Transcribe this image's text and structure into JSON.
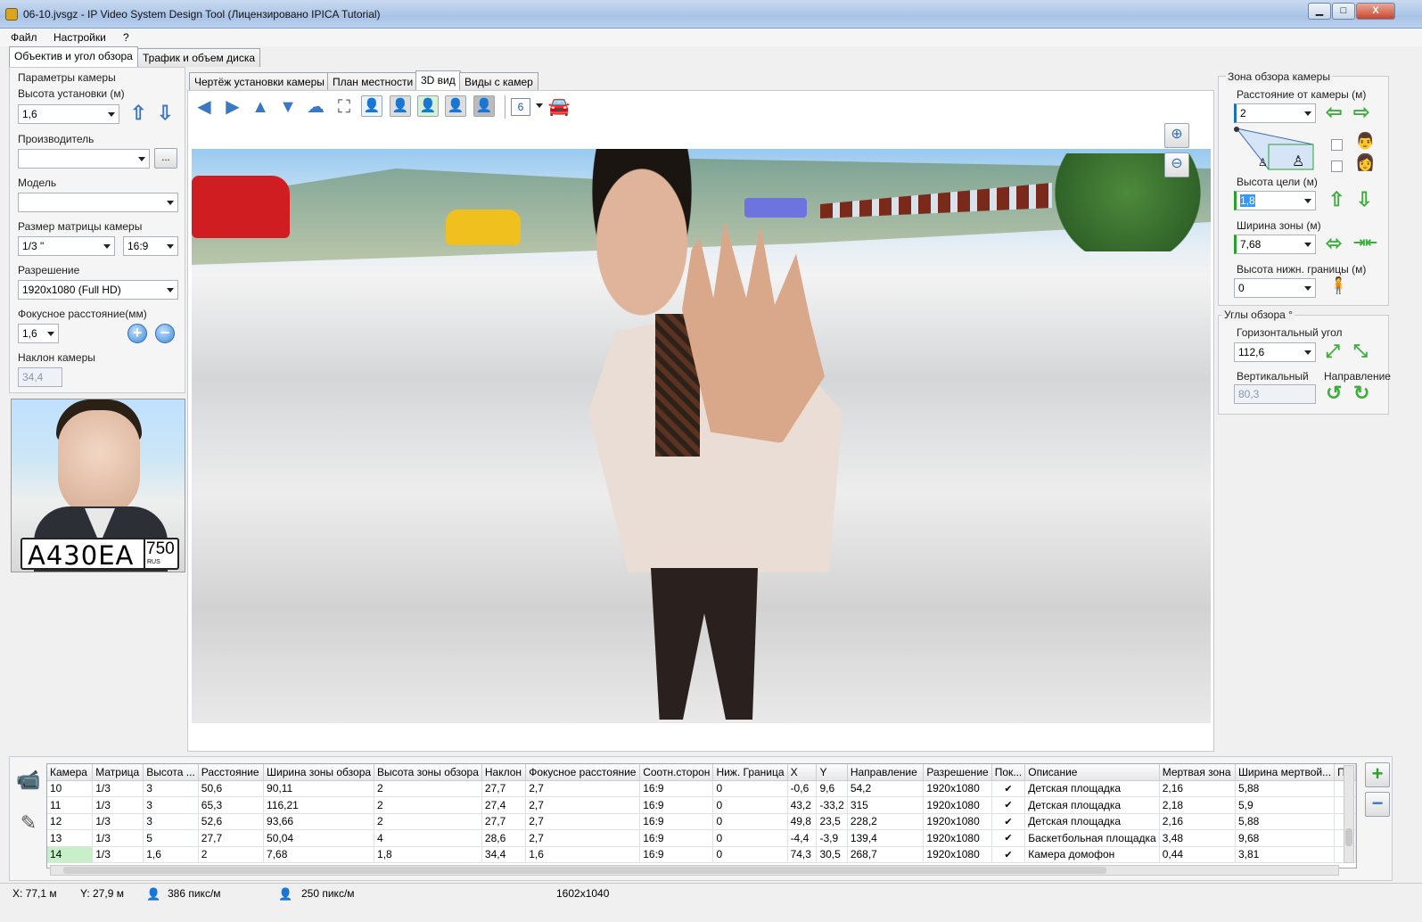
{
  "window": {
    "title": "06-10.jvsgz - IP Video System Design Tool (Лицензировано  IPICA Tutorial)",
    "btn_min": "▁",
    "btn_max": "□",
    "btn_close": "X"
  },
  "menu": [
    "Файл",
    "Настройки",
    "?"
  ],
  "left_tabs": [
    "Объектив и угол обзора",
    "Трафик и объем диска"
  ],
  "left": {
    "group_title": "Параметры камеры",
    "height_label": "Высота установки (м)",
    "height_value": "1,6",
    "maker_label": "Производитель",
    "maker_value": "",
    "maker_btn": "...",
    "model_label": "Модель",
    "model_value": "",
    "matrix_label": "Размер матрицы камеры",
    "matrix_value": "1/3 \"",
    "aspect_value": "16:9",
    "res_label": "Разрешение",
    "res_value": "1920x1080 (Full HD)",
    "focal_label": "Фокусное расстояние(мм)",
    "focal_value": "1,6",
    "tilt_label": "Наклон камеры",
    "tilt_value": "34,4",
    "plate_text": "A430EA",
    "plate_region": "750",
    "plate_country": "RUS"
  },
  "view_tabs": [
    "Чертёж установки камеры",
    "План местности",
    "3D вид",
    "Виды с камер"
  ],
  "toolbar": {
    "camera_number": "6"
  },
  "right": {
    "zone_title": "Зона обзора камеры",
    "dist_label": "Расстояние от камеры (м)",
    "dist_value": "2",
    "target_label": "Высота цели (м)",
    "target_value": "1,8",
    "width_label": "Ширина зоны (м)",
    "width_value": "7,68",
    "lower_label": "Высота нижн. границы (м)",
    "lower_value": "0",
    "angles_title": "Углы обзора °",
    "hangle_label": "Горизонтальный угол",
    "hangle_value": "112,6",
    "vangle_label": "Вертикальный",
    "vangle_value": "80,3",
    "dir_label": "Направление"
  },
  "table": {
    "headers": [
      "Камера",
      "Матрица",
      "Высота ...",
      "Расстояние",
      "Ширина зоны обзора",
      "Высота зоны обзора",
      "Наклон",
      "Фокусное расстояние",
      "Соотн.сторон",
      "Ниж. Граница",
      "X",
      "Y",
      "Направление",
      "Разрешение",
      "Пок...",
      "Описание",
      "Мертвая зона",
      "Ширина мертвой...",
      "Пр"
    ],
    "rows": [
      [
        "10",
        "1/3",
        "3",
        "50,6",
        "90,11",
        "2",
        "27,7",
        "2,7",
        "16:9",
        "0",
        "-0,6",
        "9,6",
        "54,2",
        "1920x1080",
        "✔",
        "Детская площадка",
        "2,16",
        "5,88",
        ""
      ],
      [
        "11",
        "1/3",
        "3",
        "65,3",
        "116,21",
        "2",
        "27,4",
        "2,7",
        "16:9",
        "0",
        "43,2",
        "-33,2",
        "315",
        "1920x1080",
        "✔",
        "Детская площадка",
        "2,18",
        "5,9",
        ""
      ],
      [
        "12",
        "1/3",
        "3",
        "52,6",
        "93,66",
        "2",
        "27,7",
        "2,7",
        "16:9",
        "0",
        "49,8",
        "23,5",
        "228,2",
        "1920x1080",
        "✔",
        "Детская площадка",
        "2,16",
        "5,88",
        ""
      ],
      [
        "13",
        "1/3",
        "5",
        "27,7",
        "50,04",
        "4",
        "28,6",
        "2,7",
        "16:9",
        "0",
        "-4,4",
        "-3,9",
        "139,4",
        "1920x1080",
        "✔",
        "Баскетбольная площадка",
        "3,48",
        "9,68",
        ""
      ],
      [
        "14",
        "1/3",
        "1,6",
        "2",
        "7,68",
        "1,8",
        "34,4",
        "1,6",
        "16:9",
        "0",
        "74,3",
        "30,5",
        "268,7",
        "1920x1080",
        "✔",
        "Камера домофон",
        "0,44",
        "3,81",
        ""
      ]
    ]
  },
  "status": {
    "x": "X: 77,1 м",
    "y": "Y: 27,9 м",
    "ppm1": "386 пикс/м",
    "ppm2": "250 пикс/м",
    "size": "1602x1040"
  },
  "colors": {
    "accent": "#3b78c4",
    "green": "#3fae3f",
    "selected_row": "#c8f0c8"
  }
}
